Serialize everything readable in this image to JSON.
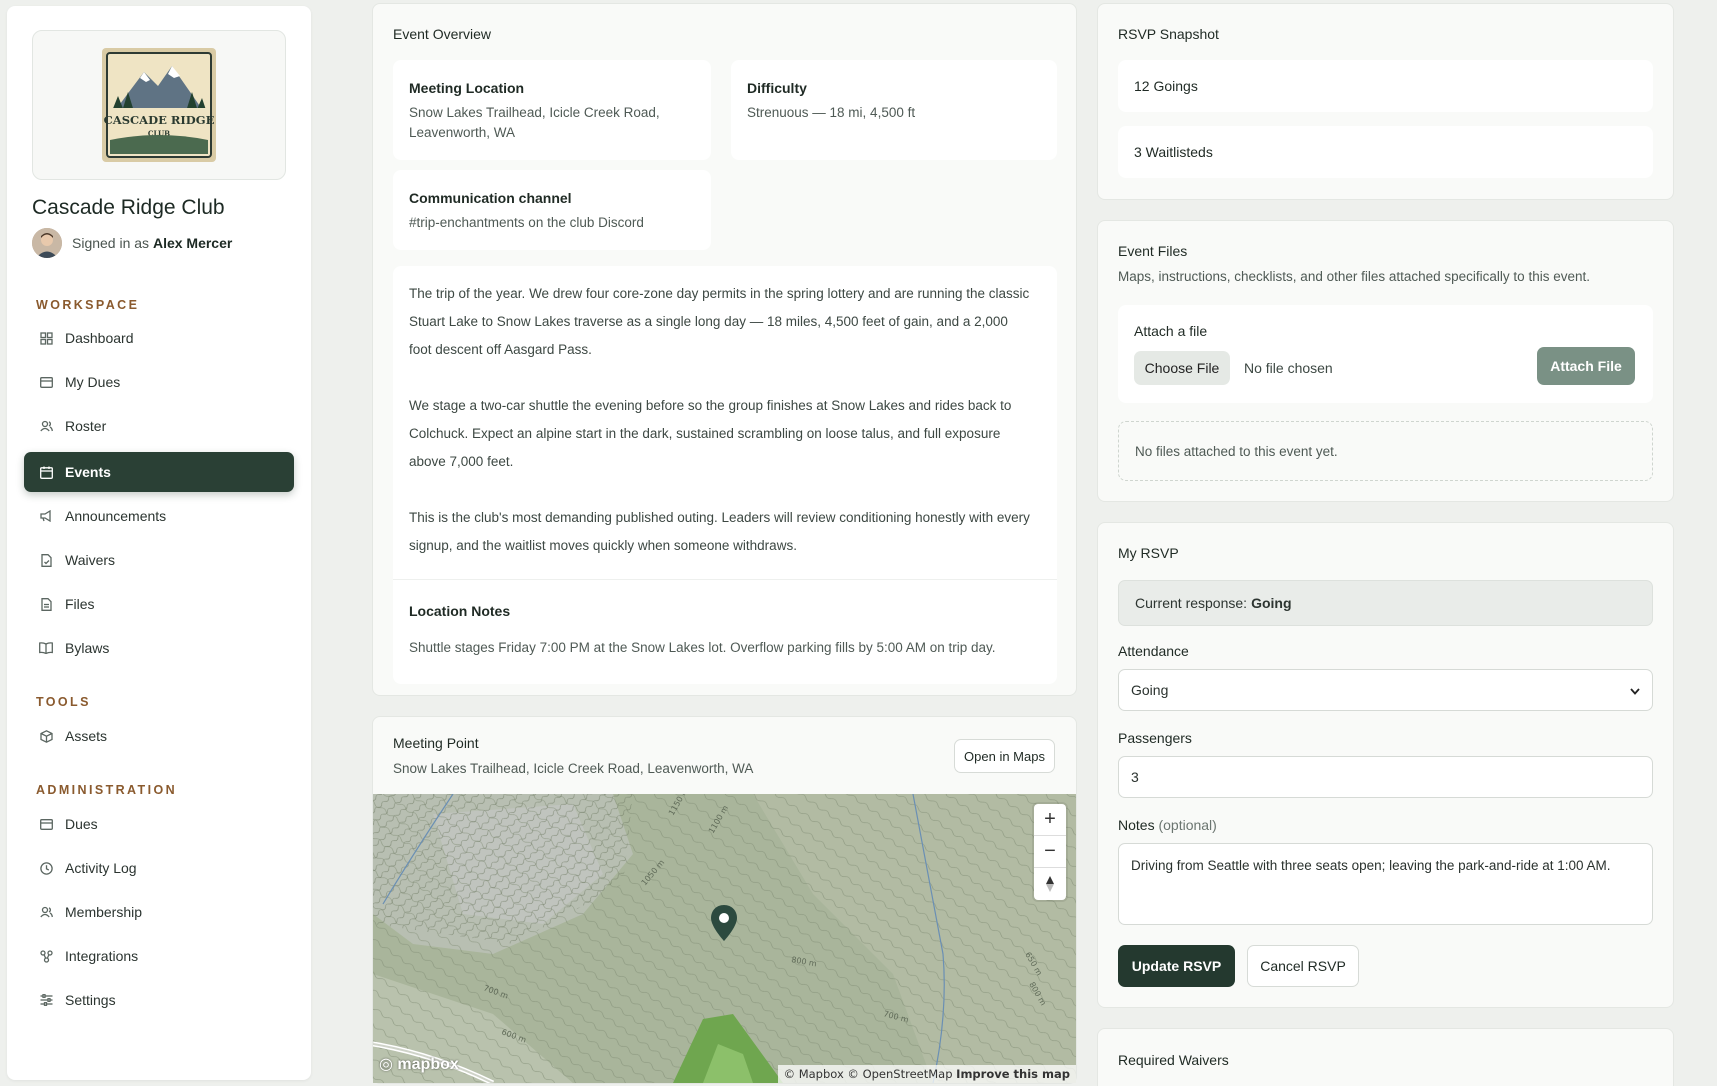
{
  "sidebar": {
    "club_name": "Cascade Ridge Club",
    "signed_prefix": "Signed in as",
    "user_name": "Alex Mercer",
    "logo": {
      "line1": "CASCADE RIDGE",
      "line2": "CLUB"
    },
    "sections": {
      "workspace": "WORKSPACE",
      "tools": "TOOLS",
      "administration": "ADMINISTRATION"
    },
    "items": [
      {
        "label": "Dashboard",
        "icon": "grid-icon"
      },
      {
        "label": "My Dues",
        "icon": "card-icon"
      },
      {
        "label": "Roster",
        "icon": "users-icon"
      },
      {
        "label": "Events",
        "icon": "calendar-icon",
        "active": true
      },
      {
        "label": "Announcements",
        "icon": "megaphone-icon"
      },
      {
        "label": "Waivers",
        "icon": "document-icon"
      },
      {
        "label": "Files",
        "icon": "file-icon"
      },
      {
        "label": "Bylaws",
        "icon": "book-icon"
      },
      {
        "label": "Assets",
        "icon": "box-icon"
      },
      {
        "label": "Dues",
        "icon": "card-icon"
      },
      {
        "label": "Activity Log",
        "icon": "clock-icon"
      },
      {
        "label": "Membership",
        "icon": "users-icon"
      },
      {
        "label": "Integrations",
        "icon": "link-icon"
      },
      {
        "label": "Settings",
        "icon": "sliders-icon"
      }
    ]
  },
  "overview": {
    "title": "Event Overview",
    "meeting_location_label": "Meeting Location",
    "meeting_location_value": "Snow Lakes Trailhead, Icicle Creek Road, Leavenworth, WA",
    "difficulty_label": "Difficulty",
    "difficulty_value": "Strenuous — 18 mi, 4,500 ft",
    "channel_label": "Communication channel",
    "channel_value": "#trip-enchantments on the club Discord",
    "description": [
      "The trip of the year. We drew four core-zone day permits in the spring lottery and are running the classic Stuart Lake to Snow Lakes traverse as a single long day — 18 miles, 4,500 feet of gain, and a 2,000 foot descent off Aasgard Pass.",
      "We stage a two-car shuttle the evening before so the group finishes at Snow Lakes and rides back to Colchuck. Expect an alpine start in the dark, sustained scrambling on loose talus, and full exposure above 7,000 feet.",
      "This is the club's most demanding published outing. Leaders will review conditioning honestly with every signup, and the waitlist moves quickly when someone withdraws."
    ],
    "location_notes_label": "Location Notes",
    "location_notes_value": "Shuttle stages Friday 7:00 PM at the Snow Lakes lot. Overflow parking fills by 5:00 AM on trip day."
  },
  "meeting_point": {
    "title": "Meeting Point",
    "address": "Snow Lakes Trailhead, Icicle Creek Road, Leavenworth, WA",
    "open_maps": "Open in Maps",
    "contours": [
      "1150 m",
      "1100 m",
      "1050 m",
      "800 m",
      "700 m",
      "650 m",
      "600 m",
      "800 m",
      "700 m"
    ],
    "attribution": "© Mapbox © OpenStreetMap",
    "improve": "Improve this map",
    "brand": "mapbox"
  },
  "rsvp_snapshot": {
    "title": "RSVP Snapshot",
    "going": "12 Goings",
    "waitlisted": "3 Waitlisteds"
  },
  "files": {
    "title": "Event Files",
    "subtitle": "Maps, instructions, checklists, and other files attached specifically to this event.",
    "attach_label": "Attach a file",
    "choose": "Choose File",
    "no_file": "No file chosen",
    "attach_btn": "Attach File",
    "empty": "No files attached to this event yet."
  },
  "my_rsvp": {
    "title": "My RSVP",
    "current_prefix": "Current response:",
    "current_value": "Going",
    "attendance_label": "Attendance",
    "attendance_value": "Going",
    "passengers_label": "Passengers",
    "passengers_value": "3",
    "notes_label": "Notes",
    "notes_optional": "(optional)",
    "notes_value": "Driving from Seattle with three seats open; leaving the park-and-ride at 1:00 AM.",
    "update_btn": "Update RSVP",
    "cancel_btn": "Cancel RSVP"
  },
  "waivers": {
    "title": "Required Waivers"
  }
}
